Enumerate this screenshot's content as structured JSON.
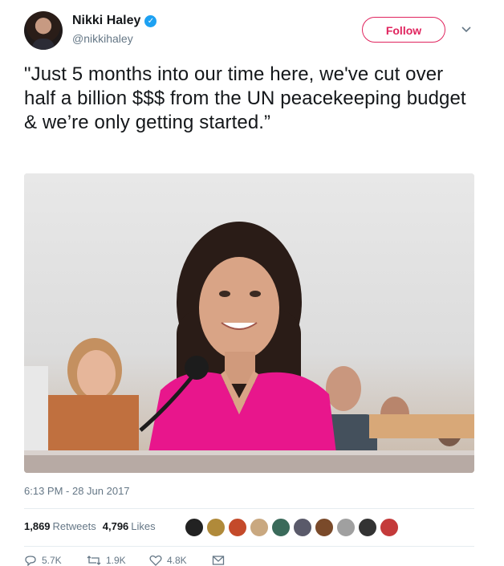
{
  "user": {
    "name": "Nikki Haley",
    "handle": "@nikkihaley",
    "follow_label": "Follow"
  },
  "tweet": {
    "text": "\"Just 5 months into our time here, we've cut over half a billion $$$ from the UN peacekeeping budget & we’re only getting started.”",
    "timestamp": "6:13 PM - 28 Jun 2017"
  },
  "stats": {
    "retweets_count": "1,869",
    "retweets_label": "Retweets",
    "likes_count": "4,796",
    "likes_label": "Likes"
  },
  "actions": {
    "reply_count": "5.7K",
    "retweet_count": "1.9K",
    "like_count": "4.8K"
  },
  "colors": {
    "follow": "#e0245e",
    "verified": "#1da1f2",
    "muted": "#657786"
  },
  "icons": [
    "verified-badge-icon",
    "chevron-down-icon",
    "reply-icon",
    "retweet-icon",
    "like-icon",
    "message-icon"
  ]
}
